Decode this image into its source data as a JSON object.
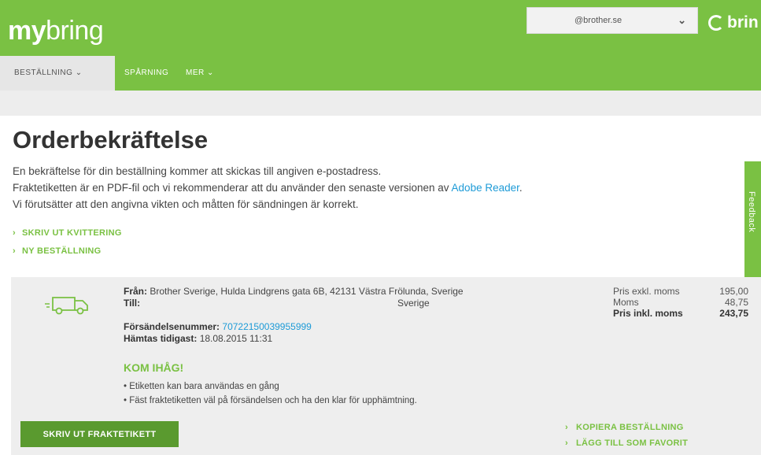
{
  "header": {
    "logo_my": "my",
    "logo_bring": "bring",
    "account_email": "@brother.se",
    "brand_text": "brin"
  },
  "nav": {
    "items": [
      {
        "label": "BESTÄLLNING ⌄"
      },
      {
        "label": "SPÅRNING"
      },
      {
        "label": "MER ⌄"
      }
    ]
  },
  "page": {
    "title": "Orderbekräftelse",
    "intro_line1": "En bekräftelse för din beställning kommer att skickas till angiven e-postadress.",
    "intro_line2_prefix": "Fraktetiketten är en PDF-fil och vi rekommenderar att du använder den senaste versionen av ",
    "intro_line2_link": "Adobe Reader",
    "intro_line2_suffix": ".",
    "intro_line3": "Vi förutsätter att den angivna vikten och måtten för sändningen är korrekt.",
    "links": [
      {
        "label": "SKRIV UT KVITTERING"
      },
      {
        "label": "NY BESTÄLLNING"
      }
    ]
  },
  "feedback": {
    "label": "Feedback"
  },
  "order": {
    "from_label": "Från:",
    "from_value": "Brother Sverige, Hulda Lindgrens gata 6B, 42131 Västra Frölunda, Sverige",
    "to_label": "Till:",
    "to_value": "Sverige",
    "shipment_label": "Försändelsenummer:",
    "shipment_number": "70722150039955999",
    "pickup_label": "Hämtas tidigast:",
    "pickup_value": "18.08.2015 11:31",
    "remember_title": "KOM IHÅG!",
    "bullets": [
      "• Etiketten kan bara användas en gång",
      "• Fäst fraktetiketten väl på försändelsen och ha den klar för upphämtning."
    ],
    "prices": [
      {
        "label": "Pris exkl. moms",
        "value": "195,00"
      },
      {
        "label": "Moms",
        "value": "48,75"
      },
      {
        "label": "Pris inkl. moms",
        "value": "243,75"
      }
    ],
    "print_button": "SKRIV UT FRAKTETIKETT",
    "bottom_links": [
      {
        "label": "KOPIERA BESTÄLLNING"
      },
      {
        "label": "LÄGG TILL SOM FAVORIT"
      }
    ]
  },
  "colors": {
    "brand_green": "#7ac143",
    "button_green": "#5a9a2f",
    "link_blue": "#1e9bd7"
  },
  "icons": [
    "chevron-down-icon",
    "chevron-right-icon",
    "truck-icon",
    "bring-logo-icon"
  ]
}
